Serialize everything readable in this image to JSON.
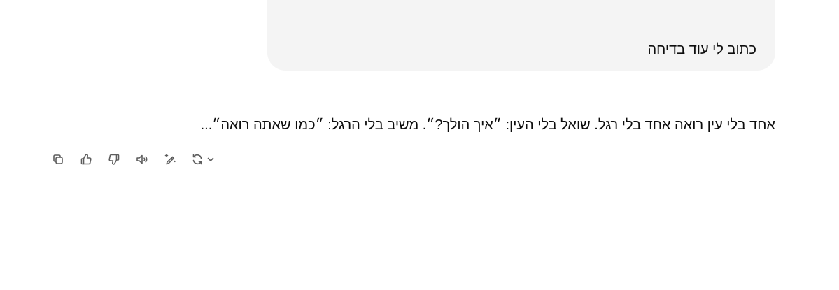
{
  "conversation": {
    "user_message": "כתוב לי עוד בדיחה",
    "assistant_message": "אחד בלי עין רואה אחד בלי רגל. שואל בלי העין: ״איך הולך?״. משיב בלי הרגל: ״כמו שאתה רואה״..."
  },
  "actions": [
    {
      "name": "copy",
      "icon": "copy-icon"
    },
    {
      "name": "good-response",
      "icon": "thumbs-up-icon"
    },
    {
      "name": "bad-response",
      "icon": "thumbs-down-icon"
    },
    {
      "name": "read-aloud",
      "icon": "speaker-icon"
    },
    {
      "name": "edit-in-canvas",
      "icon": "pencil-sparkle-icon"
    },
    {
      "name": "regenerate",
      "icon": "refresh-icon",
      "has_dropdown": true
    }
  ]
}
